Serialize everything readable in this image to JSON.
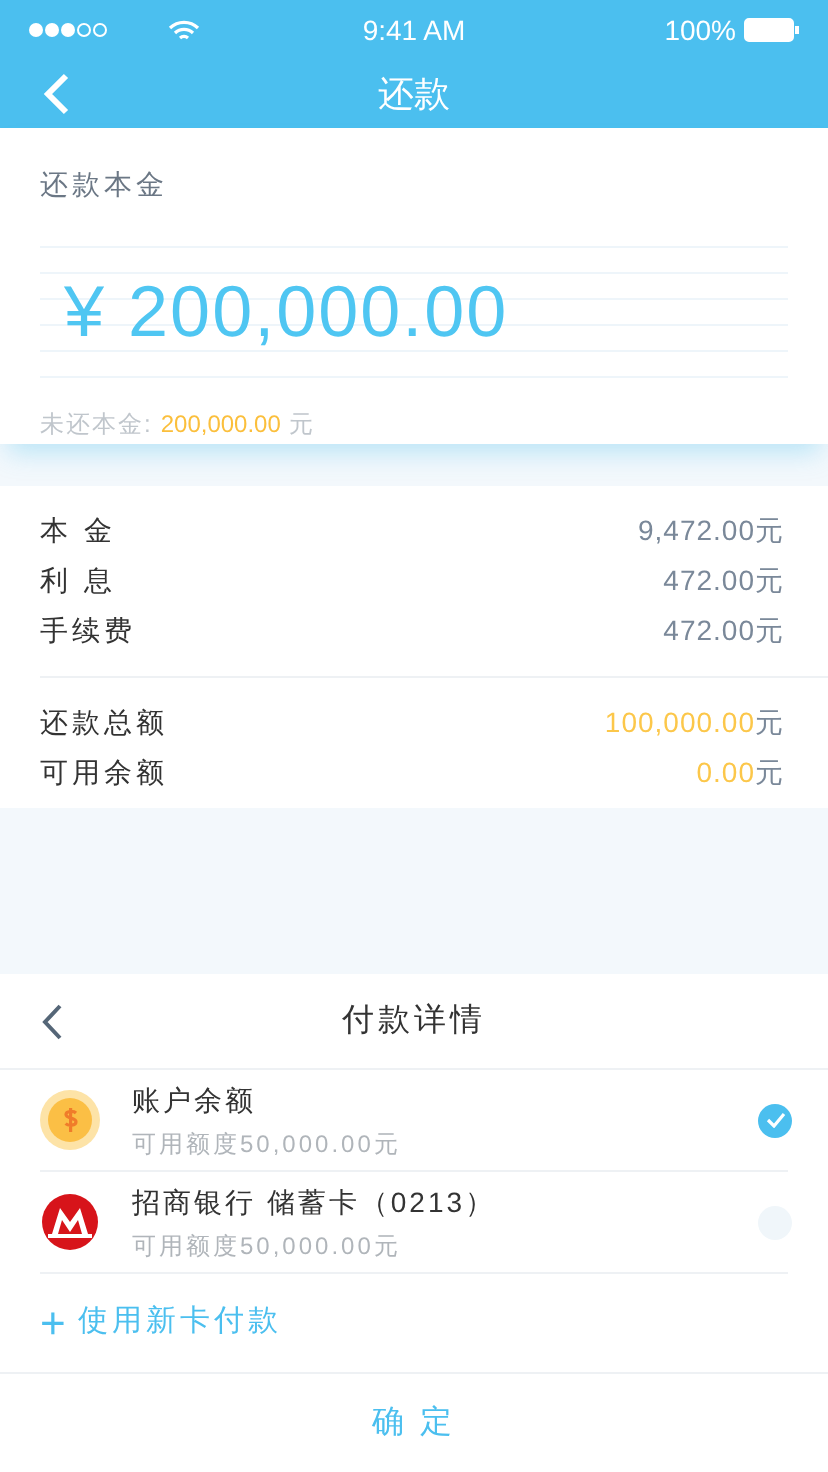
{
  "status_bar": {
    "time": "9:41 AM",
    "battery": "100%"
  },
  "nav": {
    "title": "还款"
  },
  "principal_card": {
    "label": "还款本金",
    "amount": "¥ 200,000.00",
    "remaining_label": "未还本金:",
    "remaining_value": "200,000.00",
    "remaining_unit": "元"
  },
  "details": {
    "charges": [
      {
        "label": "本 金",
        "value": "9,472.00",
        "unit": "元",
        "highlight": false
      },
      {
        "label": "利 息",
        "value": "472.00",
        "unit": "元",
        "highlight": false
      },
      {
        "label": "手续费",
        "value": "472.00",
        "unit": "元",
        "highlight": false
      }
    ],
    "totals": [
      {
        "label": "还款总额",
        "value": "100,000.00",
        "unit": "元",
        "highlight": true
      },
      {
        "label": "可用余额",
        "value": "0.00",
        "unit": "元",
        "highlight": true
      }
    ]
  },
  "payment_sheet": {
    "title": "付款详情",
    "methods": [
      {
        "kind": "coin",
        "name": "账户余额",
        "limit": "可用额度50,000.00元",
        "selected": true
      },
      {
        "kind": "bank",
        "name": "招商银行 储蓄卡（0213）",
        "limit": "可用额度50,000.00元",
        "selected": false
      }
    ],
    "add_card": {
      "icon": "+",
      "label": "使用新卡付款"
    },
    "confirm": "确 定"
  }
}
